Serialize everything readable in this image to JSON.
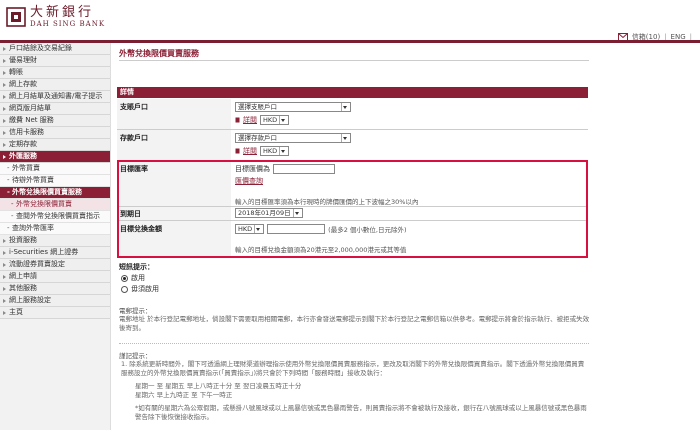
{
  "header": {
    "bank_name_cn": "大新銀行",
    "bank_name_en": "DAH SING BANK",
    "mail_label": "信箱(10)",
    "lang_en": "ENG"
  },
  "sidebar": {
    "items": [
      {
        "label": "戶口結餘及交易紀錄"
      },
      {
        "label": "優易理財"
      },
      {
        "label": "轉賬"
      },
      {
        "label": "網上存款"
      },
      {
        "label": "網上月結單及通知書/電子提示"
      },
      {
        "label": "網頁版月結單"
      },
      {
        "label": "繳費 Net 服務"
      },
      {
        "label": "信用卡服務"
      },
      {
        "label": "定期存款"
      },
      {
        "label": "外匯服務"
      },
      {
        "label": "外幣買賣"
      },
      {
        "label": "待辦外幣買賣"
      },
      {
        "label": "外幣兌換限價買賣服務"
      },
      {
        "label": "外幣兌換限價買賣"
      },
      {
        "label": "查閱外幣兌換限價買賣指示"
      },
      {
        "label": "查詢外幣匯率"
      },
      {
        "label": "投資服務"
      },
      {
        "label": "i-Securities 網上證券"
      },
      {
        "label": "流動證券買賣設定"
      },
      {
        "label": "網上申請"
      },
      {
        "label": "其他服務"
      },
      {
        "label": "網上服務設定"
      },
      {
        "label": "主頁"
      }
    ]
  },
  "main": {
    "title": "外幣兌換限價買賣服務",
    "section": "詳情",
    "debit_label": "支賬戶口",
    "debit_select": "選擇支賬戶口",
    "debit_link": "詳閱",
    "debit_currency": "HKD",
    "credit_label": "存款戶口",
    "credit_select": "選擇存款戶口",
    "credit_link": "詳閱",
    "credit_currency": "HKD",
    "rate_label": "目標匯率",
    "rate_text": "目標匯價為",
    "rate_link": "匯價查詢",
    "rate_hint": "輸入的目標匯率須為本行現時的牌價匯價的上下波幅之30%以內",
    "expiry_label": "到期日",
    "expiry_value": "2018年01月09日",
    "amount_label": "目標兌換金額",
    "amount_currency": "HKD",
    "amount_hint": "(最多2 個小數位,日元除外)",
    "amount_note": "輸入的目標兌換金額須為20港元至2,000,000港元或其等值",
    "notify_title": "短訊提示：",
    "notify_on": "啟用",
    "notify_off": "毋須啟用",
    "note_title": "電郵提示：",
    "note_body": "電郵地址 於本行登記電郵地址，倘設閣下需要取用相關電郵，本行亦會發送電郵提示到閣下於本行登記之電郵信箱以供參考。電郵提示將會於指示執行、被拒或失效後寄到。",
    "pre_title": "謹記提示：",
    "pre_1": "1.   除系統更新時間外，閣下可透過網上理財渠道辦理指示使用外幣兌換限價買賣服務指示，更改及取消閣下的外幣兌換限價買賣指示。閣下透過外幣兌換限價買賣服務設立的外幣兌換限價買賣指示(「買賣指示」)將只會於下列時間「服務時間」接收及執行：",
    "pre_2": "星期一 至 星期五 早上八時正十分 至 翌日凌晨五時正十分",
    "pre_3": "星期六         早上九時正 至 下午一時正",
    "pre_4": "*如有關的星期六為公眾假期，或懸掛八號風球或以上風暴信號或黑色暴雨警告，則買賣指示將不會被執行及接收，銀行在八號風球或以上風暴信號或黑色暴雨警告除下後恢復接收指示。"
  },
  "colors": {
    "brand": "#8b1f35",
    "highlight": "#d8103f"
  }
}
